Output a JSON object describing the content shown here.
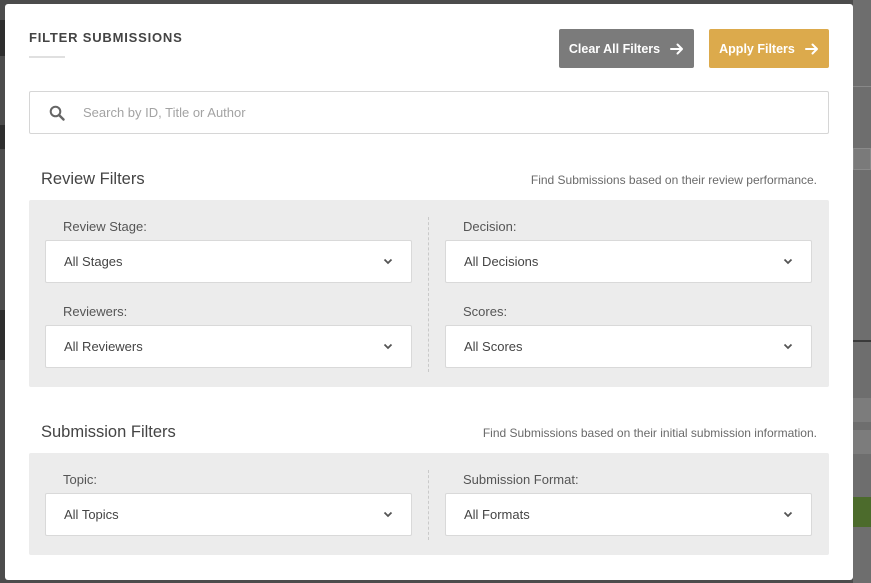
{
  "modal": {
    "title": "FILTER SUBMISSIONS",
    "clear_label": "Clear All Filters",
    "apply_label": "Apply Filters",
    "search_placeholder": "Search by ID, Title or Author"
  },
  "review_filters": {
    "title": "Review Filters",
    "description": "Find Submissions based on their review performance.",
    "fields": [
      {
        "label": "Review Stage:",
        "value": "All Stages"
      },
      {
        "label": "Decision:",
        "value": "All Decisions"
      },
      {
        "label": "Reviewers:",
        "value": "All Reviewers"
      },
      {
        "label": "Scores:",
        "value": "All Scores"
      }
    ]
  },
  "submission_filters": {
    "title": "Submission Filters",
    "description": "Find Submissions based on their initial submission information.",
    "fields": [
      {
        "label": "Topic:",
        "value": "All Topics"
      },
      {
        "label": "Submission Format:",
        "value": "All Formats"
      }
    ]
  },
  "colors": {
    "clear_button": "#7b7b7b",
    "apply_button": "#dcaa4c",
    "panel": "#ececec"
  },
  "icons": [
    "search-icon",
    "arrow-right-icon",
    "chevron-down-icon"
  ]
}
